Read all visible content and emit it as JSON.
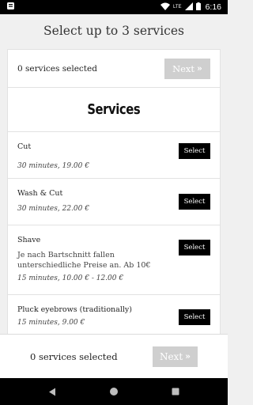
{
  "status_bar": {
    "time": "6:16",
    "network": "LTE",
    "icons": [
      "notification-icon",
      "wifi-icon",
      "signal-icon",
      "battery-icon"
    ]
  },
  "page_title": "Select up to 3 services",
  "top_bar": {
    "selected_text": "0 services selected",
    "next_label": "Next"
  },
  "services_heading": "Services",
  "services": [
    {
      "name": "Cut",
      "description": "",
      "meta": "30 minutes, 19.00 €",
      "select_label": "Select"
    },
    {
      "name": "Wash & Cut",
      "description": "",
      "meta": "30 minutes, 22.00 €",
      "select_label": "Select"
    },
    {
      "name": "Shave",
      "description": "Je nach Bartschnitt fallen unterschiedliche Preise an. Ab 10€",
      "meta": "15 minutes, 10.00 € - 12.00 €",
      "select_label": "Select"
    },
    {
      "name": "Pluck eyebrows (traditionally)",
      "description": "",
      "meta": "15 minutes, 9.00 €",
      "select_label": "Select"
    }
  ],
  "bottom_bar": {
    "selected_text": "0 services selected",
    "next_label": "Next"
  },
  "colors": {
    "primary_button": "#000000",
    "disabled_button": "#cfcfcf",
    "background": "#f0f0f0"
  }
}
